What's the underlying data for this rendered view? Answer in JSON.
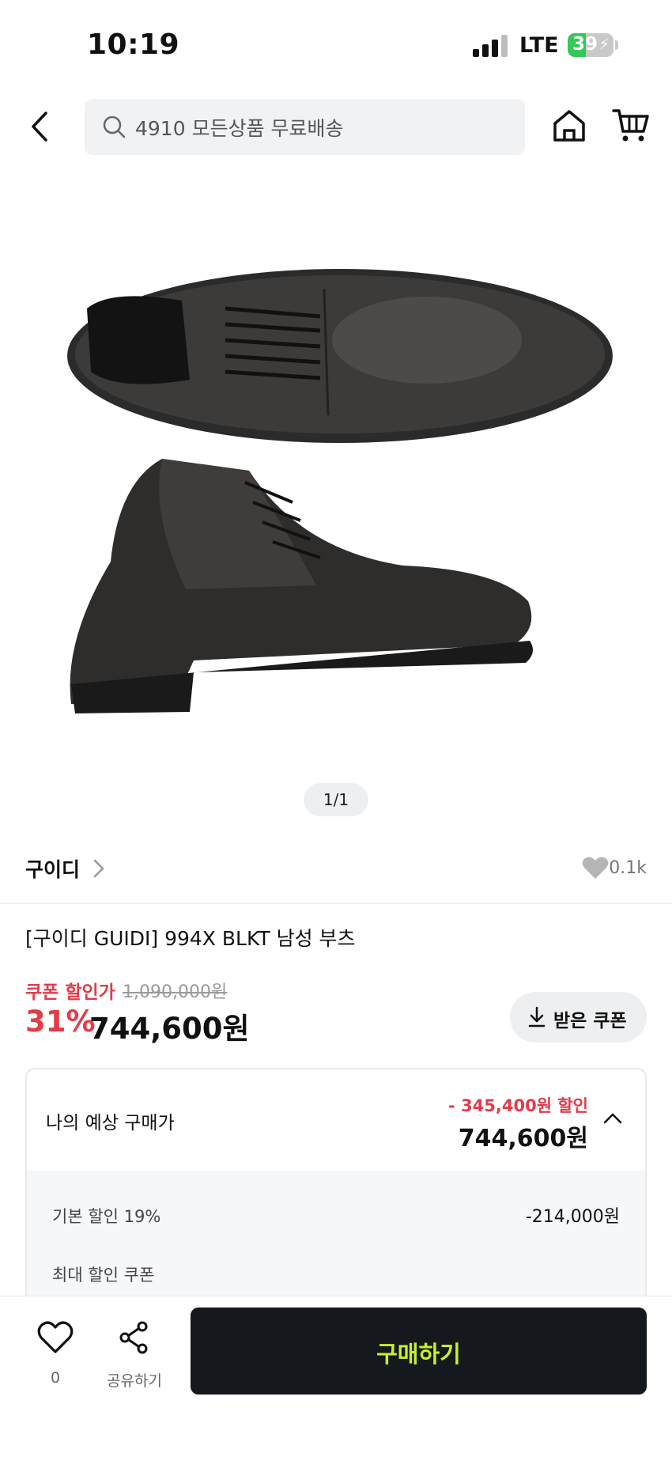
{
  "status_bar": {
    "time": "10:19",
    "network": "LTE",
    "battery": "39",
    "battery_level": 0.39
  },
  "top_nav": {
    "search_text": "4910 모든상품 무료배송",
    "icons": [
      "back-arrow-icon",
      "search-icon",
      "home-icon",
      "cart-icon"
    ]
  },
  "gallery": {
    "page_indicator": "1/1"
  },
  "brand": {
    "name": "구이디",
    "like_count": "0.1k"
  },
  "product": {
    "title": "[구이디 GUIDI] 994X BLKT 남성 부츠",
    "price_label": "쿠폰 할인가",
    "original_price": "1,090,000원",
    "discount_rate": "31%",
    "final_price": "744,600원",
    "coupon_button": "받은 쿠폰"
  },
  "estimate": {
    "title": "나의 예상 구매가",
    "discount_amount": "- 345,400원 할인",
    "price": "744,600원",
    "details": [
      {
        "label": "기본 할인 19%",
        "value": "-214,000원"
      },
      {
        "label": "최대 할인 쿠폰",
        "value": ""
      }
    ]
  },
  "bottom_bar": {
    "wish_count": "0",
    "share_label": "공유하기",
    "buy_label": "구매하기"
  },
  "colors": {
    "accent_red": "#e33b4a",
    "buy_button_bg": "#15181d",
    "buy_button_text": "#c6f22b"
  }
}
